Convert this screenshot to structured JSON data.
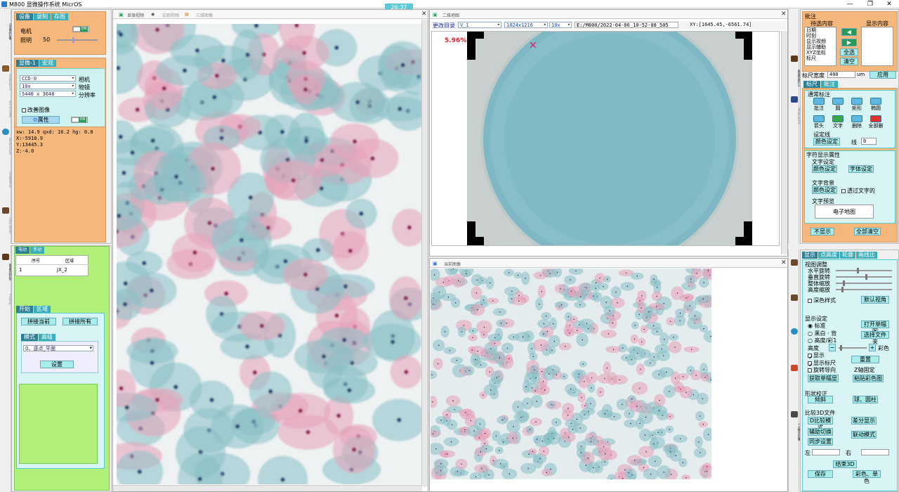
{
  "titlebar": {
    "title": "M800 显微操作系统 MicrOS",
    "timer": "26:37",
    "minimize": "—",
    "restore": "❐",
    "close": "✕"
  },
  "left_toolbar": {
    "items": [
      "设备控制",
      "显微检测",
      "显示设置",
      "存储设置",
      "网络连接",
      "设备管理",
      "运行报告"
    ]
  },
  "left_toolbar2": {
    "items": [
      "图像拼接",
      "主操作"
    ]
  },
  "device_panel": {
    "tabs": [
      "设备",
      "录制",
      "存图"
    ],
    "motor_label": "电机",
    "light_label": "照明",
    "light_value": "50",
    "on_text": "ON"
  },
  "camera_panel": {
    "tabs": [
      "显微-1",
      "宏观"
    ],
    "camera_value": "CCD-0",
    "camera_label": "相机",
    "objective_value": "10x",
    "objective_label": "物镜",
    "resolution_value": "5440 x 3648",
    "resolution_label": "分辨率",
    "improve_label": "改善图像",
    "attr_button": "属性",
    "on_text": "ON"
  },
  "status_panel": {
    "line1": "xw: 14.9 qxd: 16.2 hg: 0.0",
    "line2": "X:-5910.9",
    "line3": "Y:13445.3",
    "line4": "Z:-4.0"
  },
  "stitch_panel": {
    "tabs": [
      "电动",
      "手动"
    ],
    "col_index": "序号",
    "col_area": "区域",
    "rows": [
      {
        "index": "1",
        "area": "JX_2"
      }
    ],
    "tabs2": [
      "开始",
      "区域"
    ],
    "btn_current": "拼接当前",
    "btn_all": "拼接所有",
    "tabs3": [
      "模式",
      "高级"
    ],
    "mode_value": "0、逐点_平面",
    "set_button": "设置"
  },
  "main_view": {
    "tabs": [
      "显微视频",
      "宏观视频",
      "三维图像"
    ]
  },
  "map_view": {
    "tab": "二维地图",
    "change_dir": "更改目录",
    "folder_value": "V_1",
    "res_value": "1824x1216",
    "obj_value": "10x",
    "path": "E:/M800/2022-04-06_10-52-08_505",
    "xy": "XY:[1645.45,-6561.74]",
    "percent": "5.96%",
    "marker": "✕"
  },
  "current_image": {
    "tab": "当前图像"
  },
  "annotation_panel": {
    "title": "批注",
    "pending": "待选内容",
    "shown": "显示内容",
    "list": [
      "日期",
      "时刻",
      "显示视频",
      "显示辅助",
      "XYZ坐标",
      "标尺"
    ],
    "select_all": "全选",
    "clear": "清空",
    "ruler_width_label": "标尺宽度",
    "ruler_width_value": "400",
    "ruler_unit": "um",
    "apply": "应用",
    "tabs": [
      "标尺",
      "批注"
    ],
    "general": "通常标注",
    "tools": [
      "批注",
      "圆",
      "矩形",
      "椭圆",
      "箭头",
      "文字",
      "删除",
      "全部删"
    ],
    "set_line": "设定线",
    "color_set": "颜色设定",
    "line_label": "线",
    "line_value": "0",
    "text_attr": "字符显示属性",
    "text_set": "文字设定",
    "color_set2": "颜色设定",
    "font_set": "字体设定",
    "text_bg": "文字背景",
    "color_set3": "颜色设定",
    "transparent": "透过文字的",
    "preview": "文字预览",
    "preview_text": "电子地图",
    "hide": "不显示",
    "clear_all": "全部清空"
  },
  "right_toolbar": {
    "items": [
      "图像批注",
      "自动测量",
      "系统校正"
    ]
  },
  "right_toolbar2": {
    "items": [
      "数据管理",
      "报告",
      "三维测量"
    ]
  },
  "display_panel": {
    "tabs": [
      "显示",
      "点高度",
      "轮廓",
      "画线比"
    ],
    "view_adjust": "视图调整",
    "h_rotate": "水平旋转",
    "v_rotate": "垂直旋转",
    "scale_all": "整体缩放",
    "scale_h": "高度缩放",
    "dark_style": "深色样式",
    "default_view": "默认视角",
    "display_set": "显示设定",
    "standard": "标准",
    "bw": "黑白 · 背",
    "height_color": "高度/彩1",
    "open_dir": "打开单幅图",
    "select_file": "选择文件夹",
    "height": "高度",
    "minus": "−",
    "plus": "+",
    "color": "彩色",
    "show_flag": "显示",
    "show_ruler": "显示标尺",
    "reset": "重置",
    "rotate_guide": "旋转导向",
    "z_fixed": "Z轴固定",
    "get_single": "获取单幅显",
    "paste_color": "粘贴彩色图",
    "shape_correct": "形状校正",
    "tilt": "倾斜",
    "sphere": "球、圆柱",
    "compare3d": "比较3D文件",
    "d_compare": "D比较模式",
    "diff_show": "差分显示",
    "aux_switch": "辅助切换",
    "link_mode": "联动模式",
    "sync_set": "同步设置",
    "left": "左",
    "right": "右",
    "end3d": "结束3D",
    "save": "保存",
    "color_single": "彩色、单色"
  },
  "colors": {
    "orange": "#f5b77c",
    "teal": "#3aaeb8",
    "green": "#b0f07a",
    "cyan": "#d8f4f4"
  }
}
